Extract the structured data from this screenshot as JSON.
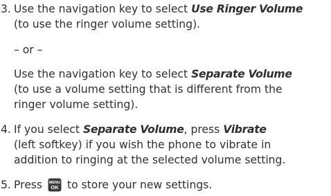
{
  "steps": [
    {
      "number": "3.",
      "line1_a": "Use the navigation key to select ",
      "line1_b": "Use Ringer Volume",
      "line2": "(to use the ringer volume setting).",
      "or": "– or –",
      "line3_a": "Use the navigation key to select ",
      "line3_b": "Separate Volume",
      "line4": "(to use a volume setting that is different from the",
      "line5": "ringer volume setting)."
    },
    {
      "number": "4.",
      "line1_a": "If you select ",
      "line1_b": "Separate Volume",
      "line1_c": ", press ",
      "line1_d": "Vibrate",
      "line2": "(left softkey) if you wish the phone to vibrate in",
      "line3": "addition to ringing at the selected volume setting."
    },
    {
      "number": "5.",
      "line1_a": "Press ",
      "key_icon": "menu-ok-key-icon",
      "key_top": "MENU",
      "key_bottom": "OK",
      "line1_b": " to store your new settings."
    }
  ]
}
